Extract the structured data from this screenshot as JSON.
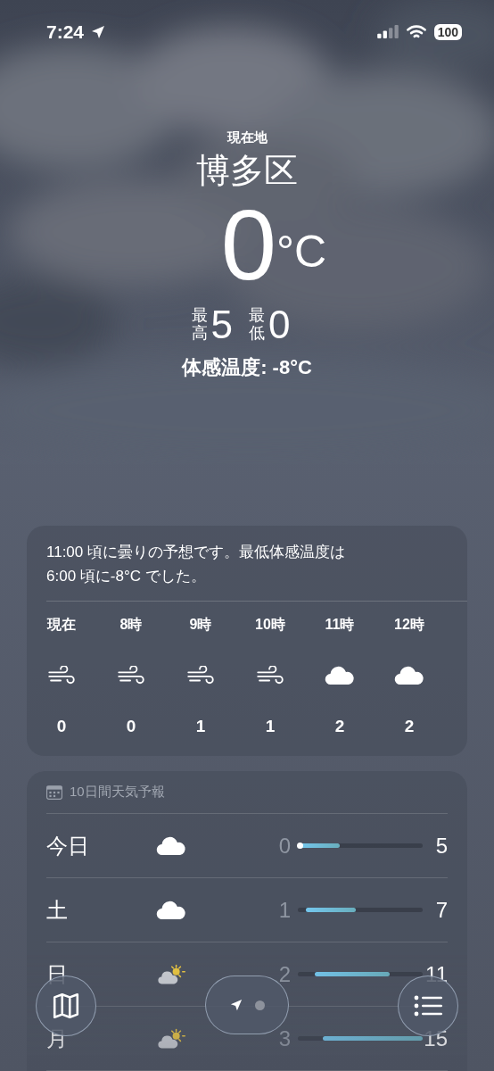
{
  "status_bar": {
    "time": "7:24",
    "battery": "100"
  },
  "header": {
    "location_label": "現在地",
    "city": "博多区",
    "temperature": "0",
    "unit": "°C",
    "high_label": "最高",
    "high": "5",
    "low_label": "最低",
    "low": "0",
    "feels_like": "体感温度: -8°C"
  },
  "hourly": {
    "summary": "11:00 頃に曇りの予想です。最低体感温度は 6:00 頃に-8°C でした。",
    "hours": [
      {
        "time": "現在",
        "kind": "wind",
        "value": "0"
      },
      {
        "time": "8時",
        "kind": "wind",
        "value": "0"
      },
      {
        "time": "9時",
        "kind": "wind",
        "value": "1"
      },
      {
        "time": "10時",
        "kind": "wind",
        "value": "1"
      },
      {
        "time": "11時",
        "kind": "cloud",
        "value": "2"
      },
      {
        "time": "12時",
        "kind": "cloud",
        "value": "2"
      }
    ]
  },
  "forecast": {
    "title": "10日間天気予報",
    "days": [
      {
        "day": "今日",
        "kind": "cloud",
        "low": "0",
        "high": "5",
        "current": true
      },
      {
        "day": "土",
        "kind": "cloud",
        "low": "1",
        "high": "7",
        "current": false
      },
      {
        "day": "日",
        "kind": "partly-sunny",
        "low": "2",
        "high": "11",
        "current": false
      },
      {
        "day": "月",
        "kind": "partly-sunny",
        "low": "3",
        "high": "15",
        "current": false
      }
    ]
  },
  "toolbar": {
    "pages": [
      {
        "kind": "location",
        "selected": true
      },
      {
        "kind": "dot",
        "selected": false
      }
    ]
  }
}
